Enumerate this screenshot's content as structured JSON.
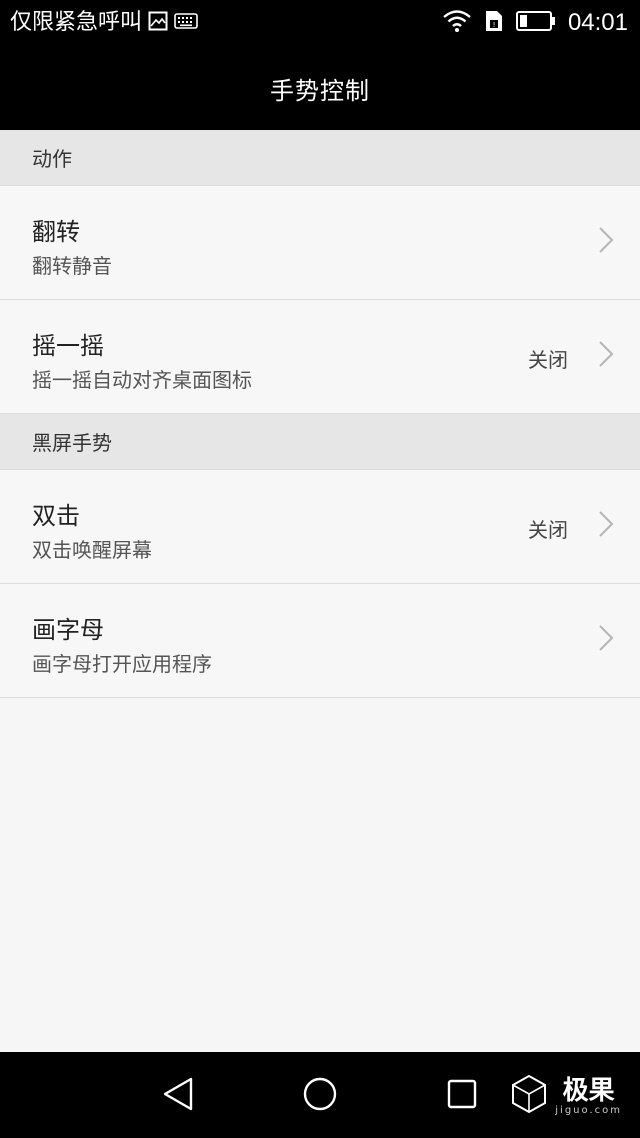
{
  "status_bar": {
    "carrier_text": "仅限紧急呼叫",
    "left_icons": [
      "image-icon",
      "keyboard-icon"
    ],
    "right_icons": [
      "wifi-icon",
      "sim-icon",
      "battery-icon"
    ],
    "time": "04:01"
  },
  "header": {
    "title": "手势控制"
  },
  "sections": [
    {
      "title": "动作",
      "items": [
        {
          "title": "翻转",
          "subtitle": "翻转静音",
          "value": ""
        },
        {
          "title": "摇一摇",
          "subtitle": "摇一摇自动对齐桌面图标",
          "value": "关闭"
        }
      ]
    },
    {
      "title": "黑屏手势",
      "items": [
        {
          "title": "双击",
          "subtitle": "双击唤醒屏幕",
          "value": "关闭"
        },
        {
          "title": "画字母",
          "subtitle": "画字母打开应用程序",
          "value": ""
        }
      ]
    }
  ],
  "nav_bar": {
    "buttons": [
      "back-icon",
      "home-icon",
      "recent-apps-icon"
    ]
  },
  "watermark": {
    "text": "极果",
    "sub": "jiguo.com"
  },
  "colors": {
    "bar_background": "#000000",
    "section_background": "#e6e6e6",
    "row_background": "#f7f7f7"
  }
}
